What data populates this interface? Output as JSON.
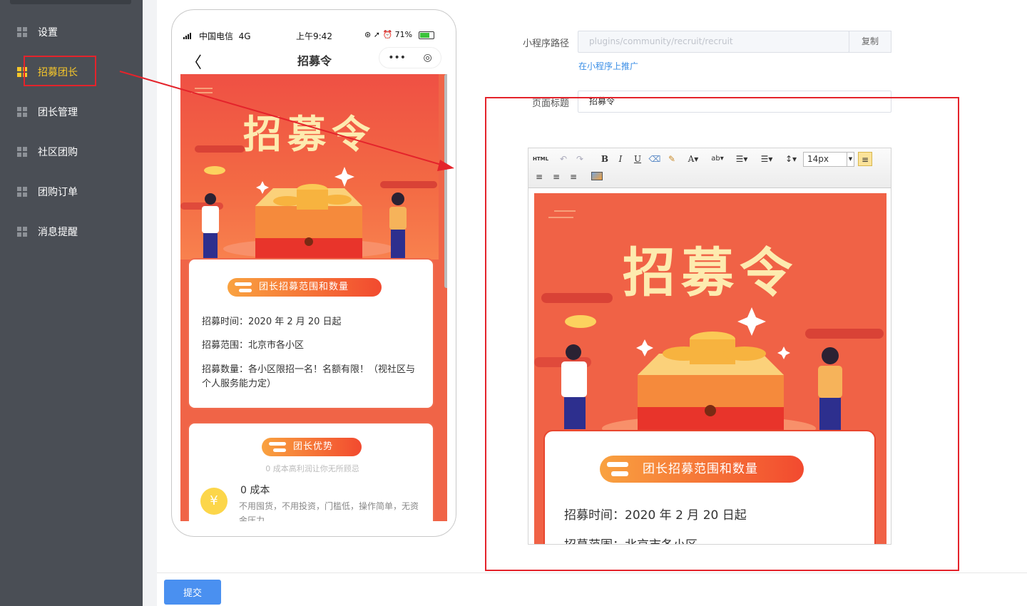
{
  "sidebar": {
    "items": [
      {
        "label": "设置",
        "active": false
      },
      {
        "label": "招募团长",
        "active": true
      },
      {
        "label": "团长管理",
        "active": false
      },
      {
        "label": "社区团购",
        "active": false
      },
      {
        "label": "团购订单",
        "active": false
      },
      {
        "label": "消息提醒",
        "active": false
      }
    ]
  },
  "phone": {
    "carrier": "中国电信",
    "network": "4G",
    "time": "上午9:42",
    "battery": "71%",
    "battery_level": 0.71,
    "nav_title": "招募令",
    "capsule_more": "•••",
    "capsule_close": "◎",
    "poster_title": "招募令",
    "card1": {
      "pill": "团长招募范围和数量",
      "line1": "招募时间：2020 年 2 月 20 日起",
      "line2": "招募范围：北京市各小区",
      "line3": "招募数量：各小区限招一名！名额有限！（视社区与个人服务能力定）"
    },
    "card2": {
      "pill": "团长优势",
      "subtitle": "0 成本高利润让你无所顾忌",
      "item_title": "0 成本",
      "item_desc": "不用囤货，不用投资，门槛低，操作简单，无资金压力。"
    }
  },
  "form": {
    "path_label": "小程序路径",
    "path_value": "plugins/community/recruit/recruit",
    "copy_label": "复制",
    "promote_link": "在小程序上推广",
    "title_label": "页面标题",
    "title_value": "招募令",
    "font_size": "14px"
  },
  "editor": {
    "html_btn": "HTML",
    "poster_title": "招募令",
    "pill": "团长招募范围和数量",
    "line1": "招募时间：2020 年 2 月 20 日起",
    "line2": "招募范围：北京市各小区"
  },
  "footer": {
    "submit_label": "提交"
  },
  "colors": {
    "sidebar_bg": "#4a4e55",
    "active": "#f7c72a",
    "primary": "#4a90f0",
    "highlight": "#e4232b",
    "poster_red": "#ef5044"
  }
}
